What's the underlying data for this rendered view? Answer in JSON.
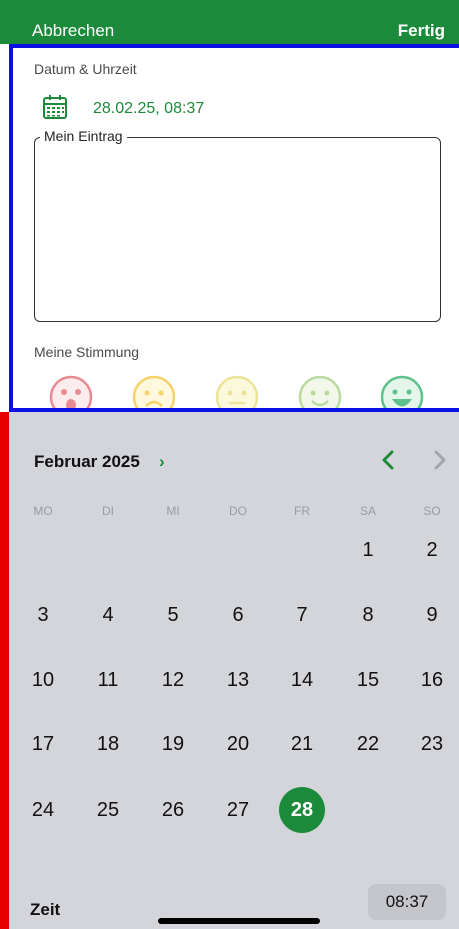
{
  "header": {
    "cancel_label": "Abbrechen",
    "done_label": "Fertig",
    "accent_color": "#1b8a3a"
  },
  "form": {
    "date_label": "Datum & Uhrzeit",
    "date_icon": "calendar-icon",
    "date_value": "28.02.25, 08:37",
    "entry_label": "Mein Eintrag",
    "entry_value": "",
    "mood_label": "Meine Stimmung",
    "moods": [
      {
        "icon": "very-sad-face-icon",
        "color": "#e88b93"
      },
      {
        "icon": "sad-face-icon",
        "color": "#f5d36a"
      },
      {
        "icon": "neutral-face-icon",
        "color": "#ece39a"
      },
      {
        "icon": "happy-face-icon",
        "color": "#b9dba0"
      },
      {
        "icon": "very-happy-face-icon",
        "color": "#5ec08a"
      }
    ]
  },
  "picker": {
    "month_title": "Februar 2025",
    "month_chevron": "›",
    "prev_icon": "chevron-left-icon",
    "next_icon": "chevron-right-icon",
    "weekdays": [
      "MO",
      "DI",
      "MI",
      "DO",
      "FR",
      "SA",
      "SO"
    ],
    "weeks": [
      [
        "",
        "",
        "",
        "",
        "",
        "1",
        "2"
      ],
      [
        "3",
        "4",
        "5",
        "6",
        "7",
        "8",
        "9"
      ],
      [
        "10",
        "11",
        "12",
        "13",
        "14",
        "15",
        "16"
      ],
      [
        "17",
        "18",
        "19",
        "20",
        "21",
        "22",
        "23"
      ],
      [
        "24",
        "25",
        "26",
        "27",
        "28",
        "",
        ""
      ]
    ],
    "selected_day": "28",
    "time_label": "Zeit",
    "time_value": "08:37"
  }
}
